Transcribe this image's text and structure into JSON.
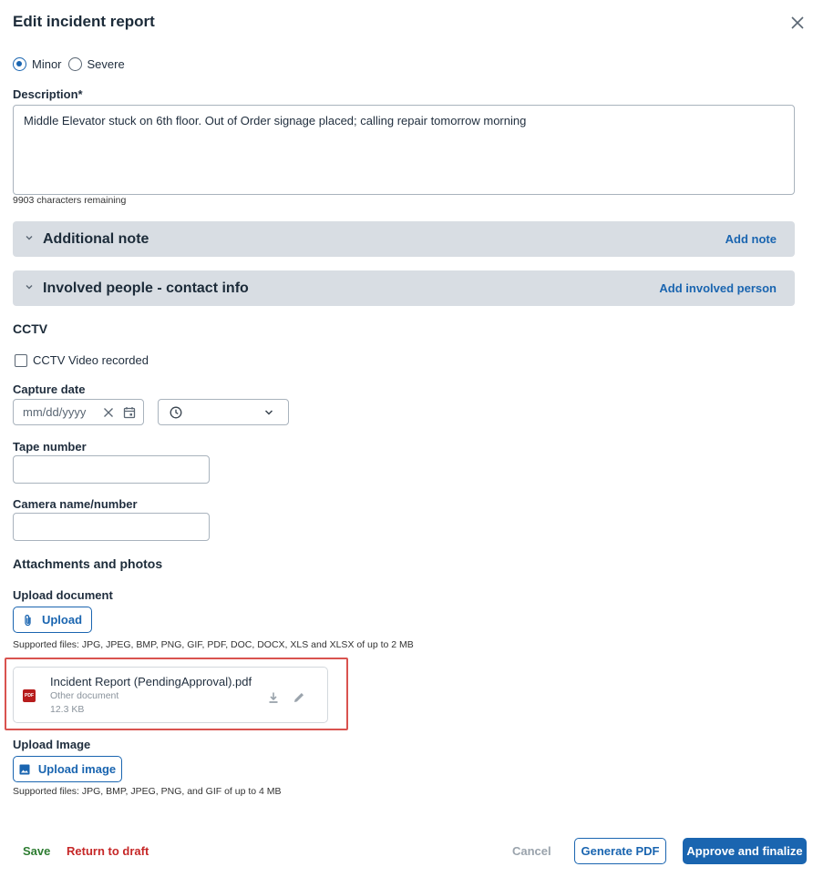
{
  "dialog": {
    "title": "Edit incident report"
  },
  "severity": {
    "options": [
      "Minor",
      "Severe"
    ],
    "selected": "Minor"
  },
  "description": {
    "label": "Description*",
    "value": "Middle Elevator stuck on 6th floor.  Out of Order signage placed; calling repair tomorrow morning",
    "remaining": "9903 characters remaining"
  },
  "accordions": [
    {
      "title": "Additional note",
      "action": "Add note"
    },
    {
      "title": "Involved people - contact info",
      "action": "Add involved person"
    }
  ],
  "cctv": {
    "heading": "CCTV",
    "checkbox_label": "CCTV Video recorded",
    "capture_date_label": "Capture date",
    "date_placeholder": "mm/dd/yyyy",
    "tape_label": "Tape number",
    "camera_label": "Camera name/number"
  },
  "attachments": {
    "heading": "Attachments and photos",
    "upload_doc_label": "Upload document",
    "upload_button": "Upload",
    "doc_supported": "Supported files: JPG, JPEG, BMP, PNG, GIF, PDF, DOC, DOCX, XLS and XLSX of up to 2 MB",
    "file": {
      "name": "Incident Report (PendingApproval).pdf",
      "type": "Other document",
      "size": "12.3 KB",
      "badge": "PDF"
    },
    "upload_image_label": "Upload Image",
    "upload_image_button": "Upload image",
    "image_supported": "Supported files: JPG, BMP, JPEG, PNG, and GIF of up to 4 MB"
  },
  "footer": {
    "save": "Save",
    "return_to_draft": "Return to draft",
    "cancel": "Cancel",
    "generate_pdf": "Generate PDF",
    "approve": "Approve and finalize"
  },
  "colors": {
    "accent": "#1a65b0",
    "save_green": "#2e7d32",
    "return_red": "#c62828",
    "primary_button": "#1a65b0",
    "highlight_red": "#d9534f"
  }
}
